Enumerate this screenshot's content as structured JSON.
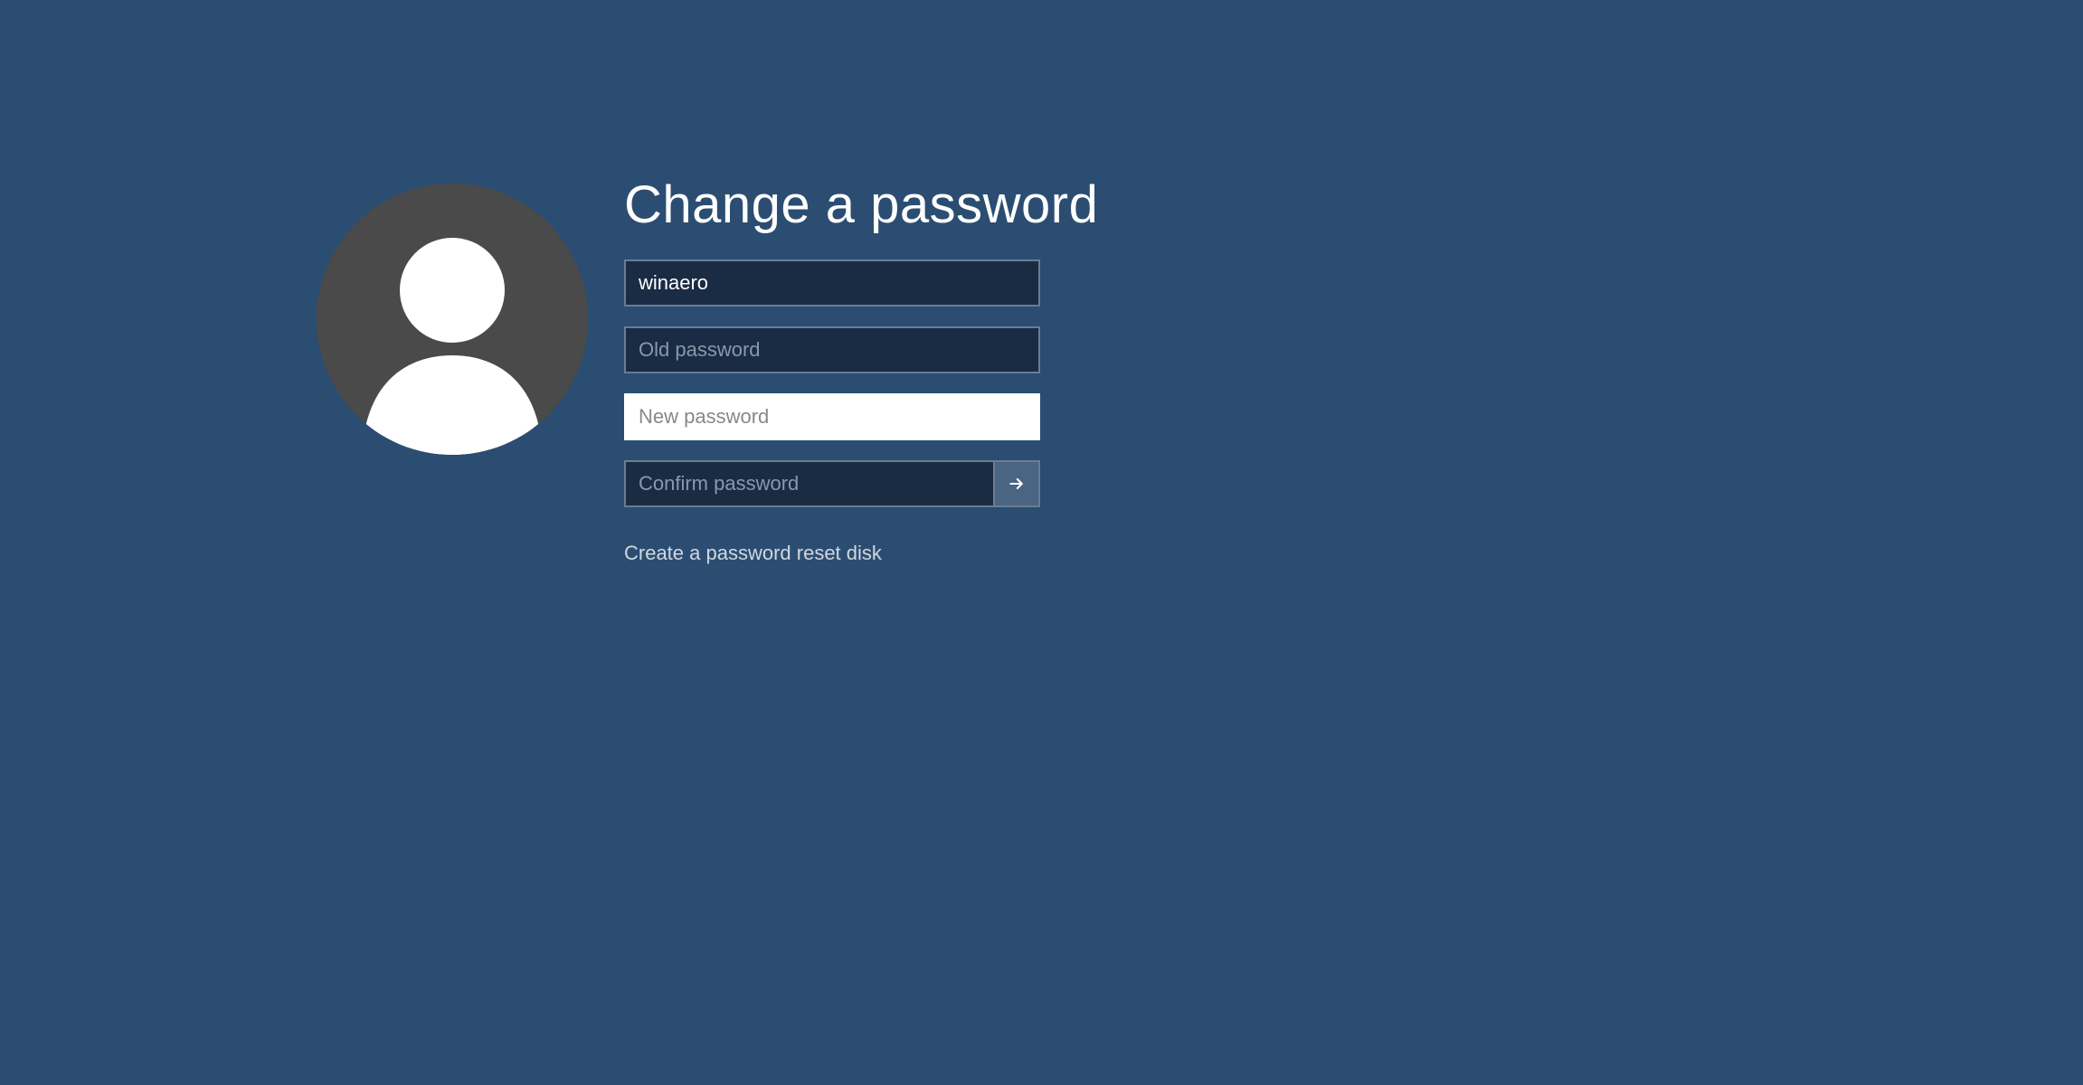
{
  "title": "Change a password",
  "fields": {
    "username": {
      "value": "winaero"
    },
    "old_password": {
      "placeholder": "Old password",
      "value": ""
    },
    "new_password": {
      "placeholder": "New password",
      "value": ""
    },
    "confirm_password": {
      "placeholder": "Confirm password",
      "value": ""
    }
  },
  "links": {
    "reset_disk": "Create a password reset disk"
  }
}
